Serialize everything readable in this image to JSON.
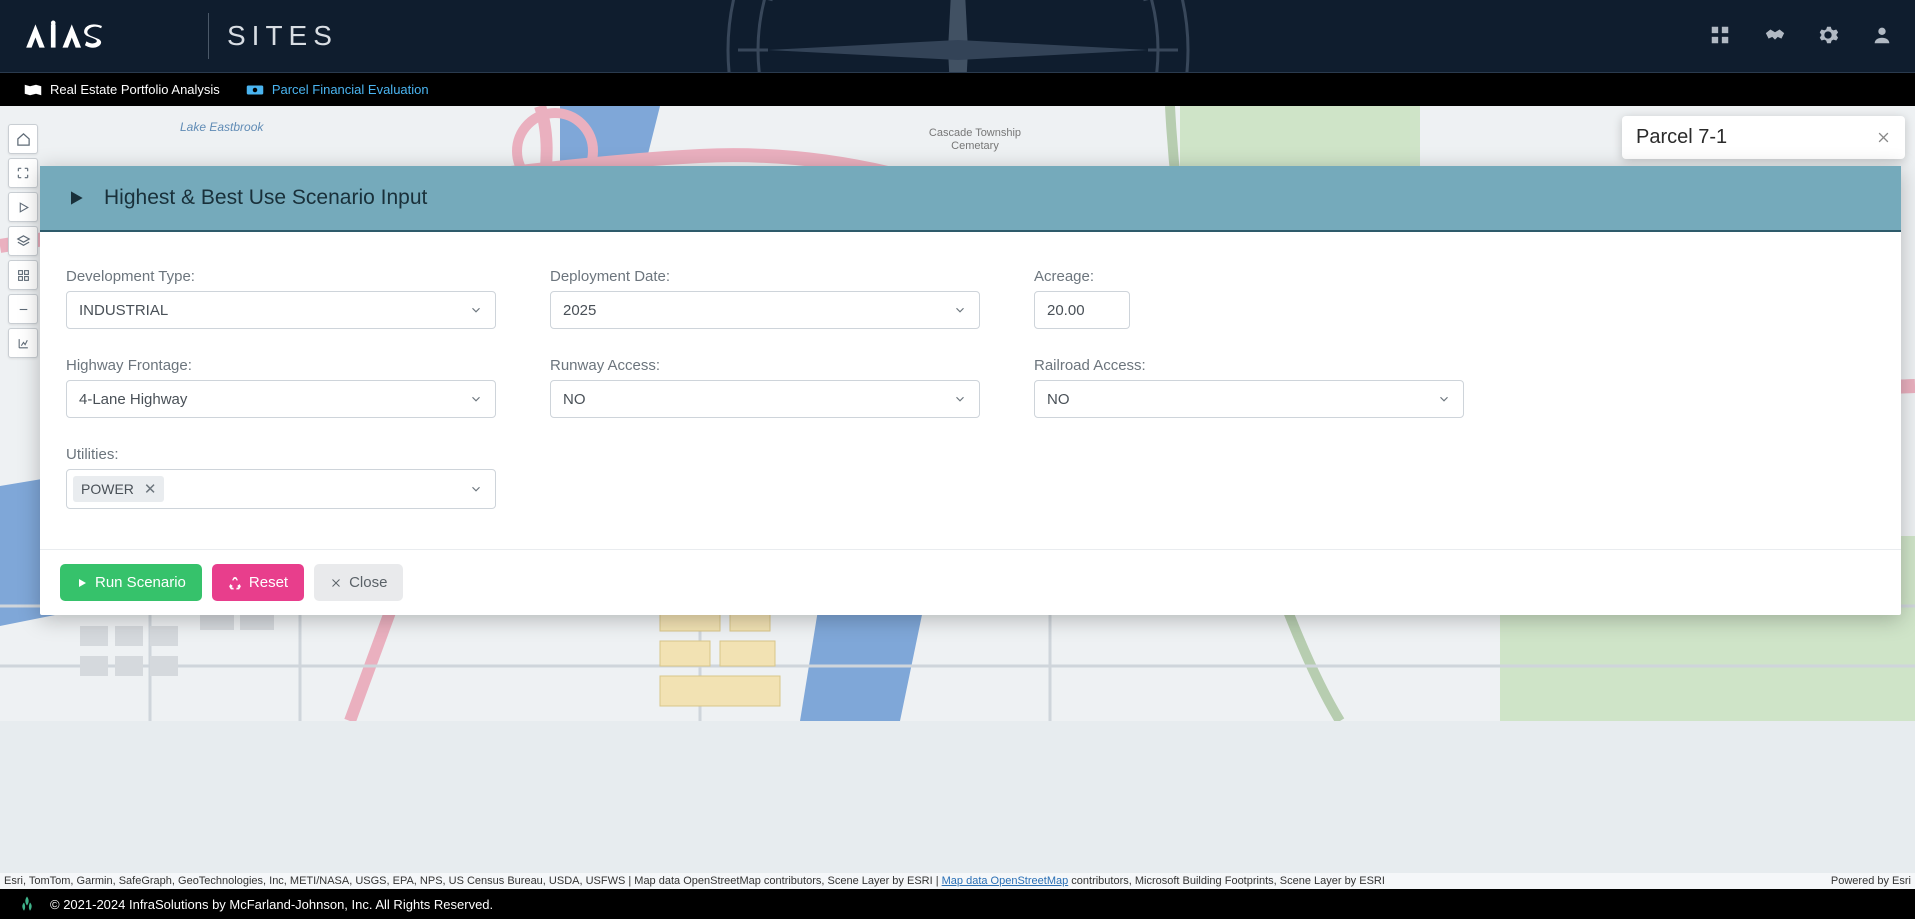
{
  "brand": {
    "main": "AIAS",
    "sub": "SITES"
  },
  "subnav": {
    "item1": "Real Estate Portfolio Analysis",
    "item2": "Parcel Financial Evaluation"
  },
  "parcel": {
    "title": "Parcel 7-1"
  },
  "scenario": {
    "title": "Highest & Best Use Scenario Input",
    "fields": {
      "dev_type": {
        "label": "Development Type:",
        "value": "INDUSTRIAL"
      },
      "deploy_date": {
        "label": "Deployment Date:",
        "value": "2025"
      },
      "acreage": {
        "label": "Acreage:",
        "value": "20.00"
      },
      "hwy": {
        "label": "Highway Frontage:",
        "value": "4-Lane Highway"
      },
      "runway": {
        "label": "Runway Access:",
        "value": "NO"
      },
      "rail": {
        "label": "Railroad Access:",
        "value": "NO"
      },
      "utilities": {
        "label": "Utilities:",
        "tag": "POWER"
      }
    },
    "buttons": {
      "run": "Run Scenario",
      "reset": "Reset",
      "close": "Close"
    }
  },
  "map_labels": {
    "l1": "Lake Eastbrook",
    "l2": "Cascade Township Cemetary"
  },
  "attribution": {
    "left": "Esri, TomTom, Garmin, SafeGraph, GeoTechnologies, Inc, METI/NASA, USGS, EPA, NPS, US Census Bureau, USDA, USFWS | Map data OpenStreetMap contributors, Scene Layer by ESRI | ",
    "link": "Map data OpenStreetMap",
    "left2": " contributors, Microsoft Building Footprints, Scene Layer by ESRI",
    "right": "Powered by Esri"
  },
  "footer": "© 2021-2024 InfraSolutions by McFarland-Johnson, Inc. All Rights Reserved."
}
